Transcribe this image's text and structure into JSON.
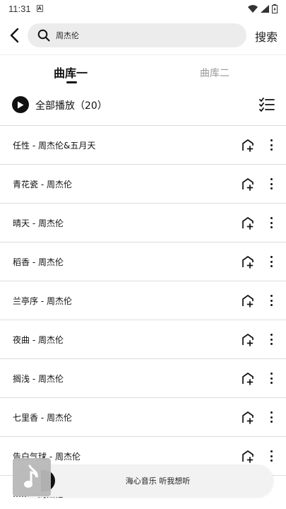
{
  "status_bar": {
    "time": "11:31",
    "badge": "A"
  },
  "search": {
    "query": "周杰伦",
    "submit_label": "搜索"
  },
  "tabs": [
    {
      "label": "曲库一",
      "active": true
    },
    {
      "label": "曲库二",
      "active": false
    }
  ],
  "play_all": {
    "label": "全部播放（20）"
  },
  "songs": [
    {
      "title": "任性 - 周杰伦&五月天"
    },
    {
      "title": "青花瓷 - 周杰伦"
    },
    {
      "title": "晴天 - 周杰伦"
    },
    {
      "title": "稻香 - 周杰伦"
    },
    {
      "title": "兰亭序 - 周杰伦"
    },
    {
      "title": "夜曲 - 周杰伦"
    },
    {
      "title": "搁浅 - 周杰伦"
    },
    {
      "title": "七里香 - 周杰伦"
    },
    {
      "title": "告白气球 - 周杰伦"
    },
    {
      "title": "…… - 周杰伦"
    }
  ],
  "mini_player": {
    "text": "海心音乐 听我想听"
  },
  "colors": {
    "primary": "#111111",
    "muted": "#999999",
    "search_bg": "#ececec",
    "divider": "#dcdcdc"
  }
}
